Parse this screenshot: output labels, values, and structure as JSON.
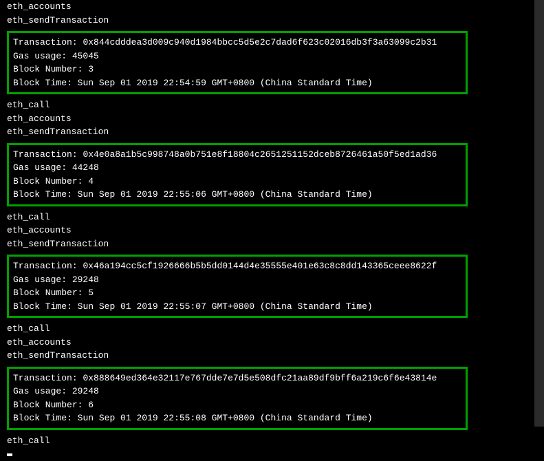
{
  "logs": {
    "group0": {
      "lines": [
        "eth_accounts",
        "eth_sendTransaction"
      ]
    },
    "group1": {
      "lines": [
        "eth_call",
        "eth_accounts",
        "eth_sendTransaction"
      ]
    },
    "group2": {
      "lines": [
        "eth_call",
        "eth_accounts",
        "eth_sendTransaction"
      ]
    },
    "group3": {
      "lines": [
        "eth_call",
        "eth_accounts",
        "eth_sendTransaction"
      ]
    },
    "group4": {
      "lines": [
        "eth_call"
      ]
    }
  },
  "transactions": [
    {
      "tx_label": "Transaction:",
      "tx_hash": "0x844cdddea3d009c940d1984bbcc5d5e2c7dad6f623c02016db3f3a63099c2b31",
      "gas_label": "Gas usage:",
      "gas_value": "45045",
      "block_num_label": "Block Number:",
      "block_num_value": "3",
      "block_time_label": "Block Time:",
      "block_time_value": "Sun Sep 01 2019 22:54:59 GMT+0800 (China Standard Time)"
    },
    {
      "tx_label": "Transaction:",
      "tx_hash": "0x4e0a8a1b5c998748a0b751e8f18804c2651251152dceb8726461a50f5ed1ad36",
      "gas_label": "Gas usage:",
      "gas_value": "44248",
      "block_num_label": "Block Number:",
      "block_num_value": "4",
      "block_time_label": "Block Time:",
      "block_time_value": "Sun Sep 01 2019 22:55:06 GMT+0800 (China Standard Time)"
    },
    {
      "tx_label": "Transaction:",
      "tx_hash": "0x46a194cc5cf1926666b5b5dd0144d4e35555e401e63c8c8dd143365ceee8622f",
      "gas_label": "Gas usage:",
      "gas_value": "29248",
      "block_num_label": "Block Number:",
      "block_num_value": "5",
      "block_time_label": "Block Time:",
      "block_time_value": "Sun Sep 01 2019 22:55:07 GMT+0800 (China Standard Time)"
    },
    {
      "tx_label": "Transaction:",
      "tx_hash": "0x888649ed364e32117e767dde7e7d5e508dfc21aa89df9bff6a219c6f6e43814e",
      "gas_label": "Gas usage:",
      "gas_value": "29248",
      "block_num_label": "Block Number:",
      "block_num_value": "6",
      "block_time_label": "Block Time:",
      "block_time_value": "Sun Sep 01 2019 22:55:08 GMT+0800 (China Standard Time)"
    }
  ]
}
